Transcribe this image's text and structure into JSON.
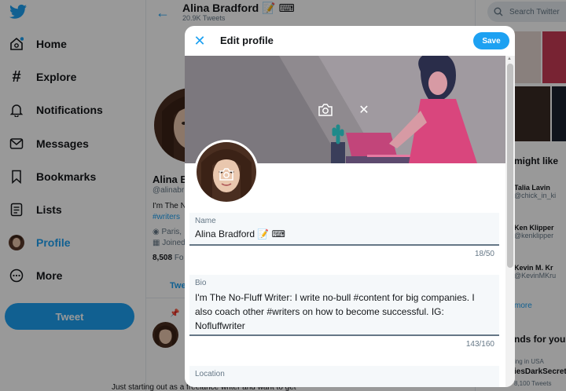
{
  "sidebar": {
    "items": [
      {
        "label": "Home",
        "icon": "home-icon"
      },
      {
        "label": "Explore",
        "icon": "hashtag-icon"
      },
      {
        "label": "Notifications",
        "icon": "bell-icon"
      },
      {
        "label": "Messages",
        "icon": "envelope-icon"
      },
      {
        "label": "Bookmarks",
        "icon": "bookmark-icon"
      },
      {
        "label": "Lists",
        "icon": "list-icon"
      },
      {
        "label": "Profile",
        "icon": "avatar-icon"
      },
      {
        "label": "More",
        "icon": "more-icon"
      }
    ],
    "tweet_label": "Tweet"
  },
  "profile_header": {
    "title": "Alina Bradford 📝 ⌨",
    "subtitle": "20.9K Tweets"
  },
  "profile": {
    "name": "Alina B",
    "handle": "@alinabr",
    "bio_line1": "I'm The N",
    "bio_line2": "#writers",
    "location": "Paris,",
    "joined": "Joined",
    "following_count": "8,508",
    "following_label": "Fo",
    "tab": "Twe"
  },
  "timeline": {
    "tweet_preview": "Just starting out as a freelance writer and want to get"
  },
  "right_panel": {
    "search_placeholder": "Search Twitter",
    "who_to_follow": "might like",
    "users": [
      {
        "name": "Talia Lavin",
        "handle": "@chick_in_ki"
      },
      {
        "name": "Ken Klipper",
        "handle": "@kenklipper"
      },
      {
        "name": "Kevin M. Kr",
        "handle": "@KevinMKru"
      }
    ],
    "show_more": "more",
    "trends_heading": "nds for you",
    "trend_context": "ing in USA",
    "trend_name": "iesDarkSecret",
    "trend_count": "8,100 Tweets"
  },
  "modal": {
    "title": "Edit profile",
    "save_label": "Save",
    "name_field": {
      "label": "Name",
      "value": "Alina Bradford 📝 ⌨",
      "counter": "18/50"
    },
    "bio_field": {
      "label": "Bio",
      "value": "I'm The No-Fluff Writer: I write no-bull #content for big companies. I also coach other #writers on how to become successful. IG: Nofluffwriter",
      "counter": "143/160"
    },
    "location_field": {
      "label": "Location",
      "value": ""
    }
  },
  "colors": {
    "accent": "#1da1f2",
    "overlay": "rgba(0,0,0,0.4)",
    "banner_bg": "#efe8ec",
    "banner_pink": "#e0457b"
  }
}
